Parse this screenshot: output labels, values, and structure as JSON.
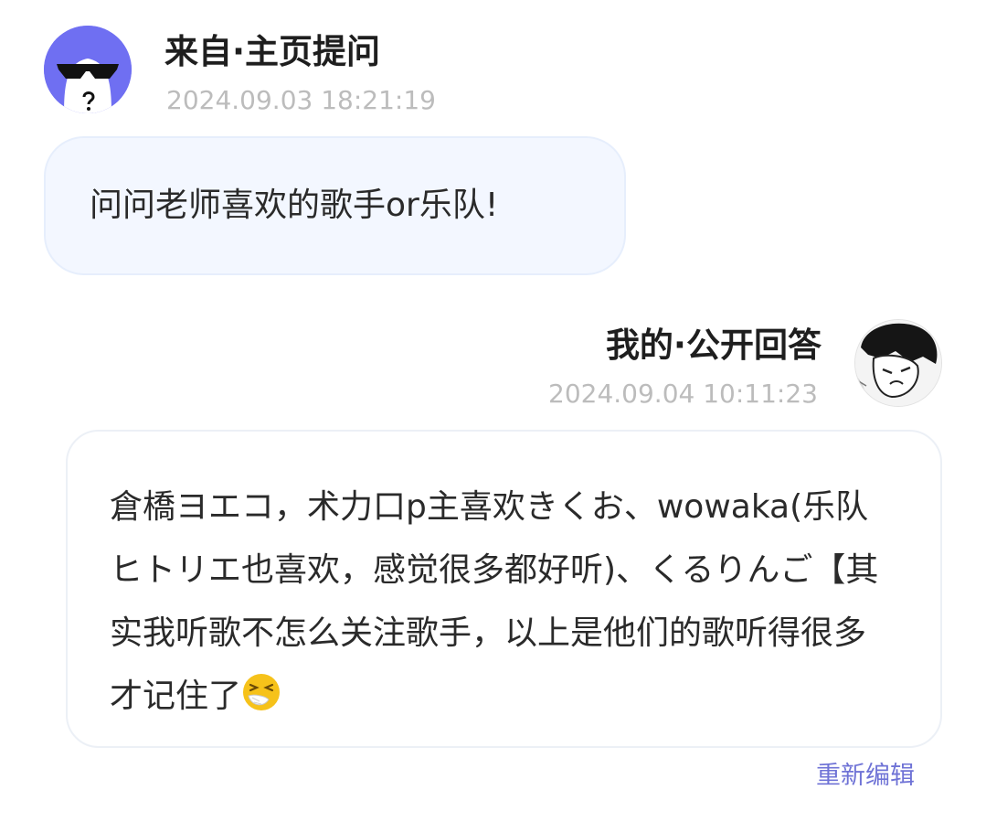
{
  "question": {
    "source_title": "来自·主页提问",
    "timestamp": "2024.09.03 18:21:19",
    "text": "问问老师喜欢的歌手or乐队!",
    "avatar_icon": "sunglasses-cartoon-avatar",
    "avatar_bg": "#6f6ff2"
  },
  "answer": {
    "title": "我的·公开回答",
    "timestamp": "2024.09.04 10:11:23",
    "text": "倉橋ヨエコ，术力口p主喜欢きくお、wowaka(乐队ヒトリエ也喜欢，感觉很多都好听)、くるりんご【其实我听歌不怎么关注歌手，以上是他们的歌听得很多才记住了",
    "emoji": "sneezing-face-emoji",
    "avatar_icon": "manga-boy-avatar"
  },
  "actions": {
    "reedit_label": "重新编辑",
    "link_color": "#6f73d6"
  }
}
